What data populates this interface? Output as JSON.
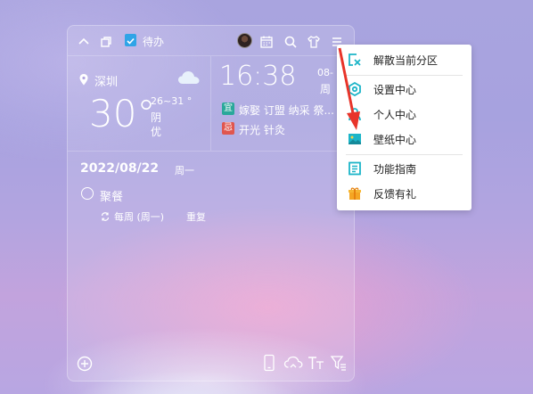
{
  "widget": {
    "todo_label": "待办",
    "weather": {
      "city": "深圳",
      "temperature": "30°",
      "range": "26~31 °",
      "condition": "阴",
      "air_quality": "优",
      "icon": "cloud-icon"
    },
    "clock": {
      "time": "16:38",
      "date_short": "08-",
      "weekday_short": "周"
    },
    "almanac": {
      "yi_tag": "宜",
      "yi_text": "嫁娶 订盟 纳采 祭...",
      "ji_tag": "忌",
      "ji_text": "开光 针灸"
    },
    "schedule": {
      "date": "2022/08/22",
      "weekday": "周一",
      "event_title": "聚餐",
      "repeat_text": "每周 (周一)",
      "repeat_label": "重复"
    }
  },
  "menu": {
    "items": [
      {
        "label": "解散当前分区",
        "icon": "ungroup-icon"
      },
      {
        "label": "设置中心",
        "icon": "settings-icon"
      },
      {
        "label": "个人中心",
        "icon": "user-icon"
      },
      {
        "label": "壁纸中心",
        "icon": "wallpaper-icon"
      },
      {
        "label": "功能指南",
        "icon": "guide-icon"
      },
      {
        "label": "反馈有礼",
        "icon": "gift-icon"
      }
    ]
  },
  "colors": {
    "accent": "#1cb5c8",
    "todo_blue": "#2fa4e7",
    "yi_green": "#2aa89a",
    "ji_red": "#e0564e",
    "arrow_red": "#e8342a"
  }
}
